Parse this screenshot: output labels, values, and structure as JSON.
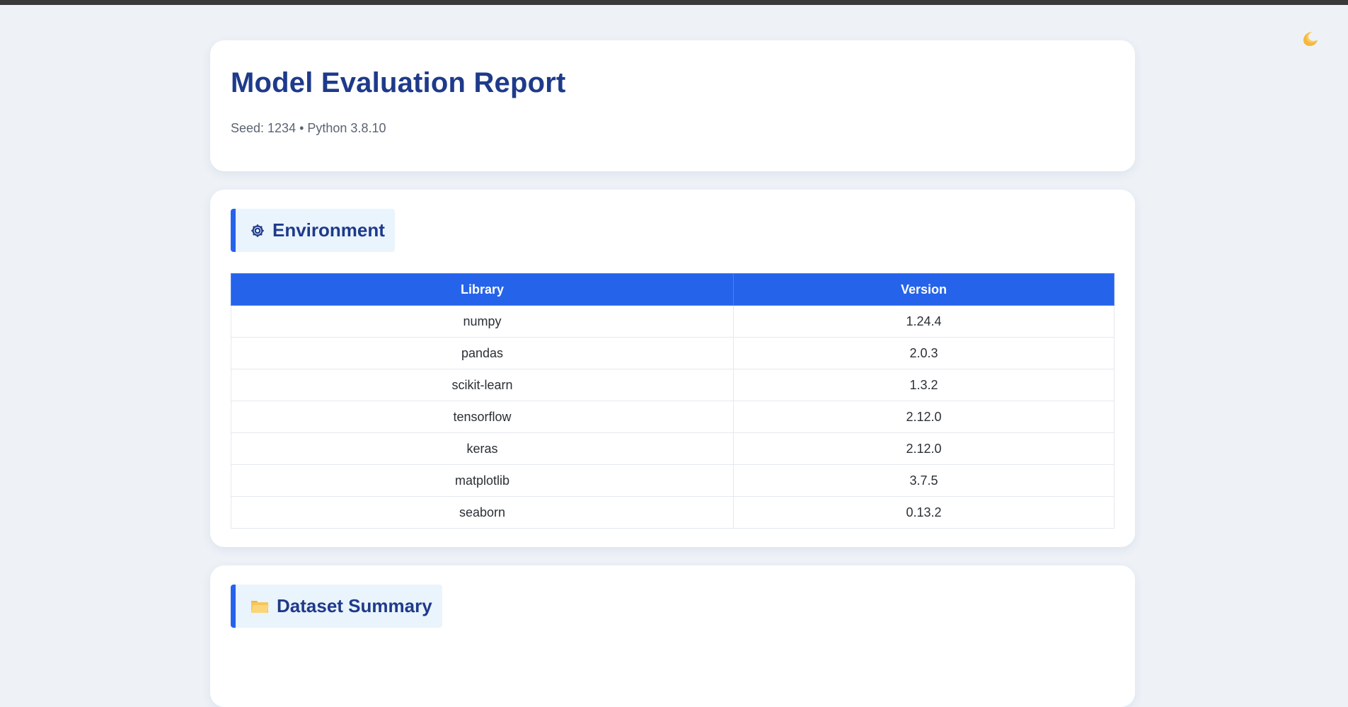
{
  "theme_toggle": {
    "icon": "crescent-moon-icon"
  },
  "header": {
    "title": "Model Evaluation Report",
    "meta": "Seed: 1234 • Python 3.8.10"
  },
  "environment": {
    "heading": "Environment",
    "icon": "gear-icon",
    "columns": {
      "library": "Library",
      "version": "Version"
    },
    "rows": [
      {
        "library": "numpy",
        "version": "1.24.4"
      },
      {
        "library": "pandas",
        "version": "2.0.3"
      },
      {
        "library": "scikit-learn",
        "version": "1.3.2"
      },
      {
        "library": "tensorflow",
        "version": "2.12.0"
      },
      {
        "library": "keras",
        "version": "2.12.0"
      },
      {
        "library": "matplotlib",
        "version": "3.7.5"
      },
      {
        "library": "seaborn",
        "version": "0.13.2"
      }
    ]
  },
  "dataset_summary": {
    "heading": "Dataset Summary",
    "icon": "open-folder-icon"
  },
  "colors": {
    "accent": "#2563eb",
    "title": "#1e3a8a",
    "page_background": "#eef2f7"
  }
}
